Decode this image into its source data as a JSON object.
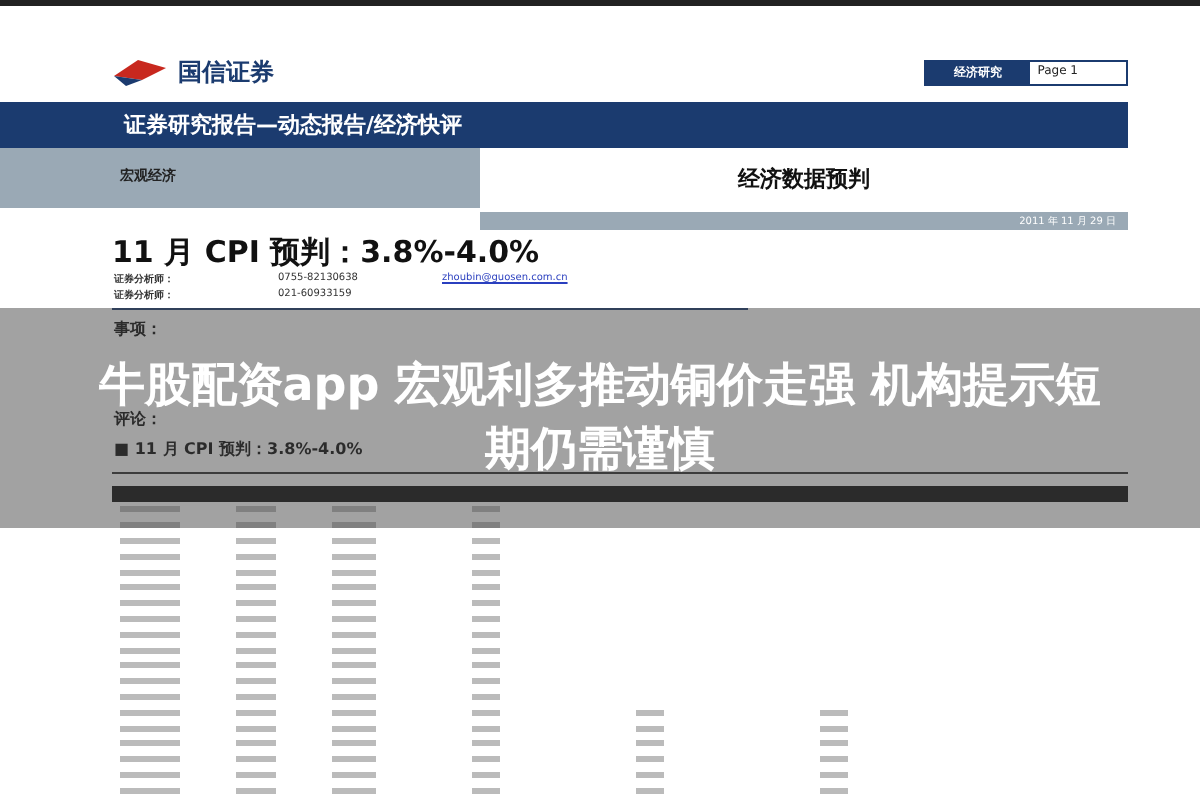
{
  "header": {
    "brand": "国信证券",
    "section_tag": "经济研究",
    "page": "Page 1"
  },
  "banner": {
    "title": "证券研究报告—动态报告/经济快评"
  },
  "category": {
    "left": "宏观经济",
    "right": "经济数据预判"
  },
  "date": "2011 年 11 月 29 日",
  "report_title": "11 月 CPI 预判：3.8%-4.0%",
  "analysts": [
    {
      "label": "证券分析师：",
      "phone": "0755-82130638",
      "email": "zhoubin@guosen.com.cn"
    },
    {
      "label": "证券分析师：",
      "phone": "021-60933159"
    }
  ],
  "sections": [
    "事项：",
    "评论：",
    "■ 11 月 CPI 预判：3.8%-4.0%"
  ],
  "overlay": {
    "headline_lines": [
      "牛股配资app 宏观利多推动铜价走强 机构提示短",
      "期仍需谨慎"
    ]
  }
}
